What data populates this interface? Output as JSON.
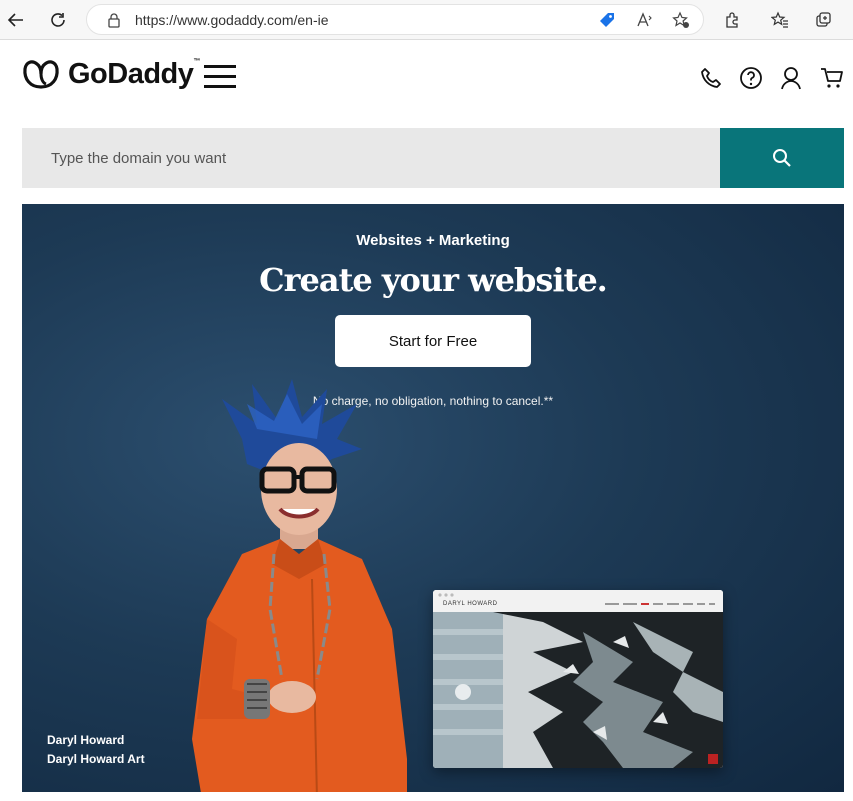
{
  "browser": {
    "url": "https://www.godaddy.com/en-ie"
  },
  "header": {
    "logo_text": "GoDaddy",
    "logo_tm": "™"
  },
  "search": {
    "placeholder": "Type the domain you want"
  },
  "hero": {
    "eyebrow": "Websites + Marketing",
    "title": "Create your website.",
    "cta_label": "Start for Free",
    "disclaimer": "No charge, no obligation, nothing to cancel.**",
    "caption_name": "Daryl Howard",
    "caption_company": "Daryl Howard Art",
    "mockup_title": "DARYL HOWARD"
  },
  "colors": {
    "search_button": "#09757a",
    "hero_background": "#1d3a55",
    "shirt": "#e35b1f"
  },
  "icons": [
    "back-icon",
    "refresh-icon",
    "lock-icon",
    "tag-icon",
    "read-aloud-icon",
    "favorite-add-icon",
    "extensions-icon",
    "favorites-icon",
    "collections-icon",
    "hamburger-icon",
    "phone-icon",
    "help-icon",
    "account-icon",
    "cart-icon",
    "search-icon"
  ]
}
